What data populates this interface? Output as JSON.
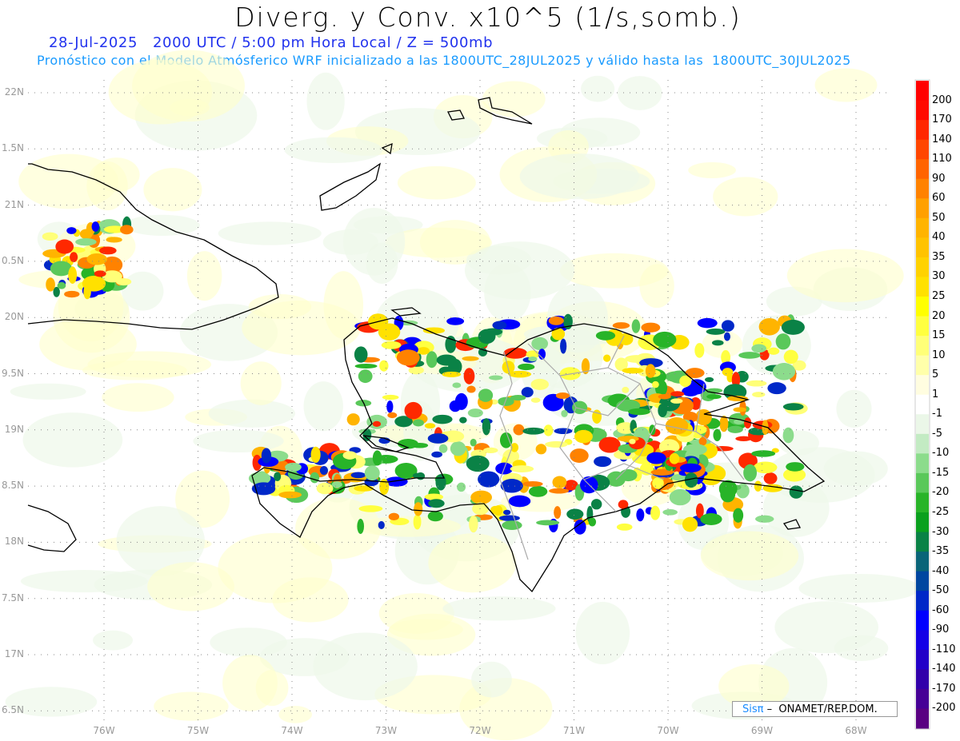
{
  "header": {
    "title": "Diverg. y Conv. x10^5 (1/s,somb.)",
    "subtitle": "28-Jul-2025   2000 UTC / 5:00 pm Hora Local / Z = 500mb",
    "description": "Pronóstico con el Modelo Atmósferico WRF inicializado a las 1800UTC_28JUL2025 y válido hasta las  1800UTC_30JUL2025"
  },
  "axes": {
    "y_labels": [
      "22N",
      "1.5N",
      "21N",
      "0.5N",
      "20N",
      "9.5N",
      "19N",
      "8.5N",
      "18N",
      "7.5N",
      "17N",
      "6.5N"
    ],
    "x_labels": [
      "76W",
      "75W",
      "74W",
      "73W",
      "72W",
      "71W",
      "70W",
      "69W",
      "68W"
    ]
  },
  "colorbar": {
    "labels": [
      "200",
      "170",
      "140",
      "110",
      "90",
      "60",
      "50",
      "40",
      "35",
      "30",
      "25",
      "20",
      "15",
      "10",
      "5",
      "1",
      "-1",
      "-5",
      "-10",
      "-15",
      "-20",
      "-25",
      "-30",
      "-35",
      "-40",
      "-50",
      "-60",
      "-90",
      "-110",
      "-140",
      "-170",
      "-200"
    ],
    "colors": [
      "#ff0000",
      "#ff0a00",
      "#ff2800",
      "#ff4600",
      "#ff6400",
      "#ff8200",
      "#ffa000",
      "#ffb400",
      "#ffc300",
      "#ffd200",
      "#ffe100",
      "#ffff00",
      "#ffff40",
      "#ffff78",
      "#ffffaa",
      "#fffde0",
      "#ffffff",
      "#ebf7e8",
      "#c3ebc3",
      "#8cdc8c",
      "#5ac85a",
      "#28b428",
      "#0aa01e",
      "#0a8246",
      "#0a6478",
      "#0046a0",
      "#0028c8",
      "#0000ff",
      "#1400e6",
      "#2300c8",
      "#3200aa",
      "#460096",
      "#5a0082"
    ]
  },
  "credit": {
    "brand": "Sisπ",
    "text": " –  ONAMET/REP.DOM."
  }
}
